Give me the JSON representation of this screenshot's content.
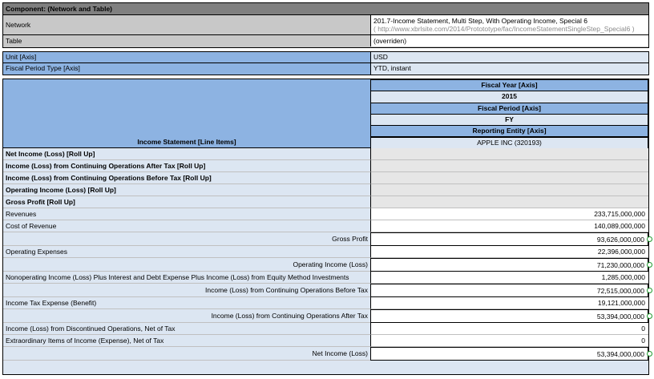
{
  "component": {
    "title": "Component: (Network and Table)"
  },
  "meta": [
    {
      "label": "Network",
      "value": "201.7-Income Statement, Multi Step, With Operating Income, Special 6",
      "value2": "( http://www.xbrlsite.com/2014/Protototype/fac/IncomeStatementSingleStep_Special6 )"
    },
    {
      "label": "Table",
      "value": "(overriden)"
    }
  ],
  "axes": [
    {
      "label": "Unit [Axis]",
      "value": "USD"
    },
    {
      "label": "Fiscal Period Type [Axis]",
      "value": "YTD, instant"
    }
  ],
  "table": {
    "row_header": "Income Statement [Line Items]",
    "column_headers": [
      {
        "text": "Fiscal Year [Axis]",
        "style": "axis"
      },
      {
        "text": "2015",
        "style": "member"
      },
      {
        "text": "Fiscal Period [Axis]",
        "style": "axis"
      },
      {
        "text": "FY",
        "style": "member"
      },
      {
        "text": "Reporting Entity [Axis]",
        "style": "axis"
      },
      {
        "text": "APPLE INC (320193)",
        "style": "member-plain"
      }
    ],
    "rows": [
      {
        "label": "Net Income (Loss) [Roll Up]",
        "value": "",
        "style": "bold"
      },
      {
        "label": "Income (Loss) from Continuing Operations After Tax [Roll Up]",
        "value": "",
        "style": "bold"
      },
      {
        "label": "Income (Loss) from Continuing Operations Before Tax [Roll Up]",
        "value": "",
        "style": "bold"
      },
      {
        "label": "Operating Income (Loss) [Roll Up]",
        "value": "",
        "style": "bold"
      },
      {
        "label": "Gross Profit [Roll Up]",
        "value": "",
        "style": "bold"
      },
      {
        "label": "Revenues",
        "value": "233,715,000,000",
        "style": "normal"
      },
      {
        "label": "Cost of Revenue",
        "value": "140,089,000,000",
        "style": "normal"
      },
      {
        "label": "Gross Profit",
        "value": "93,626,000,000",
        "style": "total"
      },
      {
        "label": "Operating Expenses",
        "value": "22,396,000,000",
        "style": "normal"
      },
      {
        "label": "Operating Income (Loss)",
        "value": "71,230,000,000",
        "style": "total"
      },
      {
        "label": "Nonoperating Income (Loss) Plus Interest and Debt Expense Plus Income (Loss) from Equity Method Investments",
        "value": "1,285,000,000",
        "style": "normal"
      },
      {
        "label": "Income (Loss) from Continuing Operations Before Tax",
        "value": "72,515,000,000",
        "style": "total"
      },
      {
        "label": "Income Tax Expense (Benefit)",
        "value": "19,121,000,000",
        "style": "normal"
      },
      {
        "label": "Income (Loss) from Continuing Operations After Tax",
        "value": "53,394,000,000",
        "style": "total"
      },
      {
        "label": "Income (Loss) from Discontinued Operations, Net of Tax",
        "value": "0",
        "style": "normal"
      },
      {
        "label": "Extraordinary Items of Income (Expense), Net of Tax",
        "value": "0",
        "style": "normal"
      },
      {
        "label": "Net Income (Loss)",
        "value": "53,394,000,000",
        "style": "total"
      }
    ]
  },
  "colors": {
    "header_gray": "#808080",
    "axis_blue": "#8db3e2",
    "light_blue": "#dce6f2",
    "check_green": "#1e9a2e"
  }
}
